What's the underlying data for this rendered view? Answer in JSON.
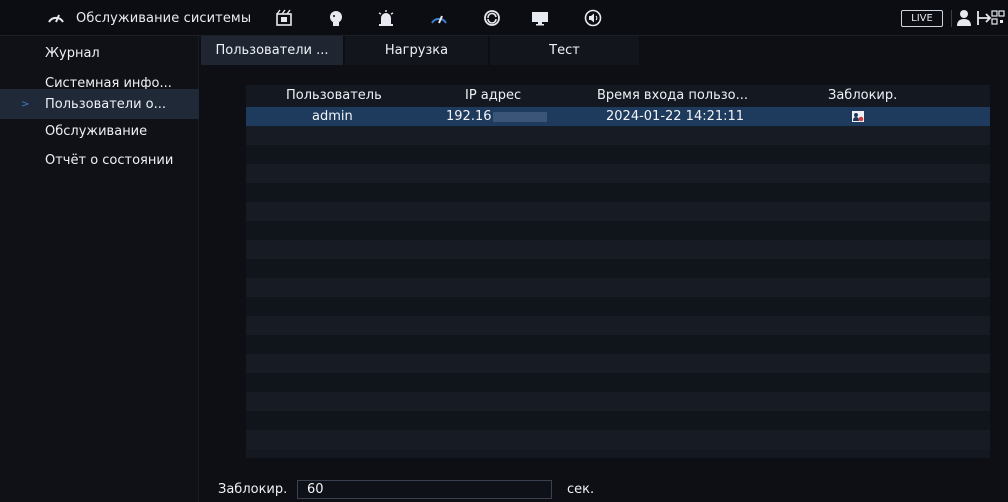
{
  "topbar": {
    "title": "Обслуживание сиситемы",
    "icons": [
      "gauge-icon",
      "film-icon",
      "face-icon",
      "alarm-icon",
      "speedometer-icon",
      "sync-icon",
      "monitor-icon",
      "speaker-icon"
    ],
    "live_label": "LIVE"
  },
  "sidebar": {
    "items": [
      {
        "label": "Журнал"
      },
      {
        "label": "Системная инфо..."
      },
      {
        "label": "Пользователи о..."
      },
      {
        "label": "Обслуживание"
      },
      {
        "label": "Отчёт о состоянии"
      }
    ],
    "active_index": 2
  },
  "tabs": [
    {
      "label": "Пользователи ..."
    },
    {
      "label": "Нагрузка"
    },
    {
      "label": "Тест"
    }
  ],
  "table": {
    "headers": [
      "Пользователь",
      "IP адрес",
      "Время входа пользо...",
      "Заблокир."
    ],
    "rows": [
      {
        "user": "admin",
        "ip": "192.16",
        "time": "2024-01-22 14:21:11",
        "blocked_icon": "block-user-icon"
      }
    ]
  },
  "footer": {
    "label": "Заблокир.",
    "value": "60",
    "unit": "сек."
  },
  "colors": {
    "background": "#0d0f14",
    "sidebar_active": "#1f2937",
    "selected_row": "#1e3a5c",
    "accent": "#3f7fd2"
  }
}
